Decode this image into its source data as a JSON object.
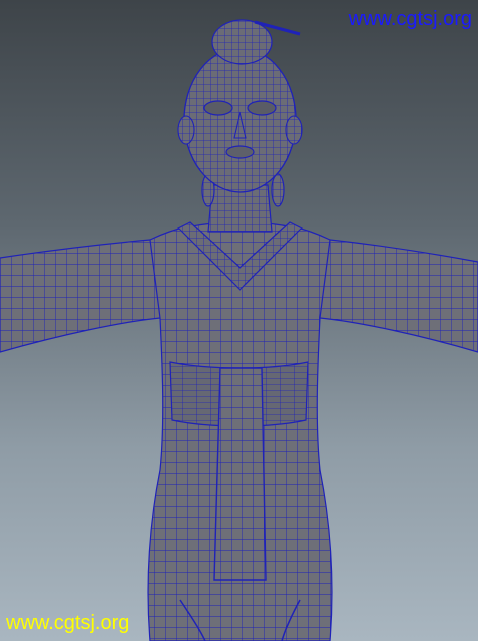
{
  "watermark_top": {
    "text": "www.cgtsj.org",
    "color": "#1a1aff"
  },
  "watermark_bottom": {
    "text": "www.cgtsj.org",
    "color": "#ffff00"
  },
  "colors": {
    "mesh_fill": "#6e6f78",
    "wire": "#1f22b8",
    "background_top": "#3e4449",
    "background_bottom": "#a9b6c0"
  },
  "icons": {
    "model": "female-character-wireframe-mesh"
  }
}
